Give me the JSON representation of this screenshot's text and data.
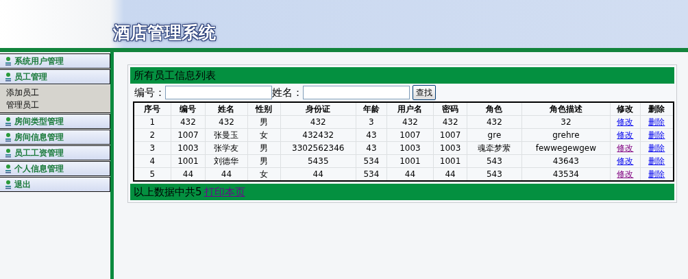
{
  "header": {
    "title": "酒店管理系统"
  },
  "sidebar": {
    "items": [
      {
        "label": "系统用户管理"
      },
      {
        "label": "员工管理",
        "children": [
          {
            "label": "添加员工"
          },
          {
            "label": "管理员工"
          }
        ]
      },
      {
        "label": "房间类型管理"
      },
      {
        "label": "房间信息管理"
      },
      {
        "label": "员工工资管理"
      },
      {
        "label": "个人信息管理"
      },
      {
        "label": "退出"
      }
    ]
  },
  "panel": {
    "title": "所有员工信息列表",
    "search": {
      "fields": [
        {
          "label": "编号："
        },
        {
          "label": "姓名："
        }
      ],
      "button": "查找"
    },
    "table": {
      "columns": [
        "序号",
        "编号",
        "姓名",
        "性别",
        "身份证",
        "年龄",
        "用户名",
        "密码",
        "角色",
        "角色描述",
        "修改",
        "删除"
      ],
      "rows": [
        {
          "cells": [
            "1",
            "432",
            "432",
            "男",
            "432",
            "3",
            "432",
            "432",
            "432",
            "32"
          ],
          "edit": {
            "label": "修改",
            "visited": false
          },
          "delete": {
            "label": "删除",
            "visited": false
          }
        },
        {
          "cells": [
            "2",
            "1007",
            "张曼玉",
            "女",
            "432432",
            "43",
            "1007",
            "1007",
            "gre",
            "grehre"
          ],
          "edit": {
            "label": "修改",
            "visited": false
          },
          "delete": {
            "label": "删除",
            "visited": false
          }
        },
        {
          "cells": [
            "3",
            "1003",
            "张学友",
            "男",
            "3302562346",
            "43",
            "1003",
            "1003",
            "魂牵梦萦",
            "fewwegewgew"
          ],
          "edit": {
            "label": "修改",
            "visited": true
          },
          "delete": {
            "label": "删除",
            "visited": false
          }
        },
        {
          "cells": [
            "4",
            "1001",
            "刘德华",
            "男",
            "5435",
            "534",
            "1001",
            "1001",
            "543",
            "43643"
          ],
          "edit": {
            "label": "修改",
            "visited": false
          },
          "delete": {
            "label": "删除",
            "visited": false
          }
        },
        {
          "cells": [
            "5",
            "44",
            "44",
            "女",
            "44",
            "534",
            "44",
            "44",
            "543",
            "43534"
          ],
          "edit": {
            "label": "修改",
            "visited": true
          },
          "delete": {
            "label": "删除",
            "visited": false
          }
        }
      ]
    },
    "footer": {
      "text": "以上数据中共5",
      "link": {
        "label": "打印本页",
        "visited": true
      }
    }
  }
}
